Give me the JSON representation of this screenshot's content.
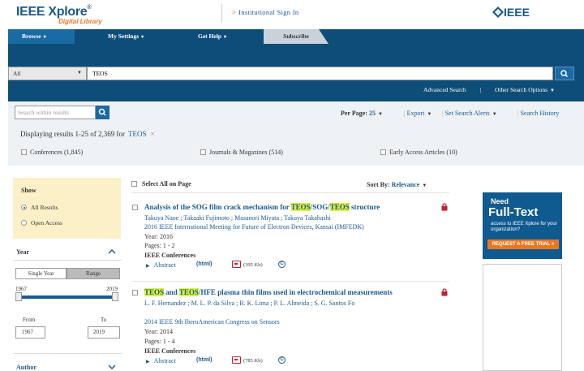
{
  "header": {
    "logo_main": "IEEE Xplore",
    "logo_reg": "®",
    "logo_sub": "Digital Library",
    "signin": "Institutional Sign In",
    "ieee_logo": "IEEE"
  },
  "nav": {
    "items": [
      {
        "label": "Browse"
      },
      {
        "label": "My Settings"
      },
      {
        "label": "Get Help"
      },
      {
        "label": "Subscribe"
      }
    ]
  },
  "search": {
    "scope": "All",
    "query": "TEOS",
    "advanced": "Advanced Search",
    "pipe": "|",
    "other_options": "Other Search Options",
    "within_placeholder": "Search within results"
  },
  "toolbar": {
    "per_page_label": "Per Page:",
    "per_page_value": "25",
    "export": "Export",
    "set_alerts": "Set Search Alerts",
    "history": "Search History",
    "sep": "|"
  },
  "results_summary": {
    "prefix": "Displaying results",
    "range": "1-25",
    "of": "of",
    "total": "2,369",
    "for": "for",
    "term": "TEOS",
    "clear": "×"
  },
  "filters": [
    {
      "label": "Conferences (1,845)"
    },
    {
      "label": "Journals & Magazines (514)"
    },
    {
      "label": "Early Access Articles (10)"
    }
  ],
  "sidebar": {
    "show_title": "Show",
    "all_results": "All Results",
    "open_access": "Open Access",
    "year_title": "Year",
    "single_year": "Single Year",
    "range": "Range",
    "min_year": "1967",
    "max_year": "2019",
    "from_label": "From",
    "to_label": "To",
    "from_value": "1967",
    "to_value": "2019",
    "author_title": "Author"
  },
  "list_controls": {
    "select_all": "Select All on Page",
    "sort_label": "Sort By:",
    "sort_value": "Relevance"
  },
  "results": [
    {
      "title_parts": [
        "Analysis of the SOG film crack mechanism for ",
        "TEOS",
        "/SOG/",
        "TEOS",
        " structure"
      ],
      "authors": "Takuya Naoe ; Takaaki Fujimoto ; Masanori Miyata ; Takuya Takahashi",
      "venue": "2016 IEEE International Meeting for Future of Electron Devices, Kansai (IMFEDK)",
      "year": "Year: 2016",
      "pages": "Pages: 1 - 2",
      "content_type": "IEEE Conferences",
      "abstract": "Abstract",
      "html": "(html)",
      "pdf_size": "(395 Kb)",
      "cc": "C"
    },
    {
      "title_parts": [
        "TEOS",
        " and ",
        "TEOS",
        "/HFE plasma thin films used in electrochemical measurements"
      ],
      "authors": "L. F. Hernandez ; M. L. P. da Silva ; R. K. Lima ; P. L. Almeida ; S. G. Santos Fo",
      "venue": "2014 IEEE 9th IberoAmerican Congress on Sensors",
      "year": "Year: 2014",
      "pages": "Pages: 1 - 4",
      "content_type": "IEEE Conferences",
      "abstract": "Abstract",
      "html": "(html)",
      "pdf_size": "(785 Kb)",
      "cc": "C"
    }
  ],
  "ad": {
    "need": "Need",
    "full_text": "Full-Text",
    "body": "access to IEEE Xplore for your organization?",
    "button": "REQUEST A FREE TRIAL >"
  },
  "colors": {
    "nav": "#0e4d78",
    "link": "#1a5a8f",
    "accent": "#e87722",
    "highlight": "#d9f23a",
    "lock": "#c21e2d"
  }
}
